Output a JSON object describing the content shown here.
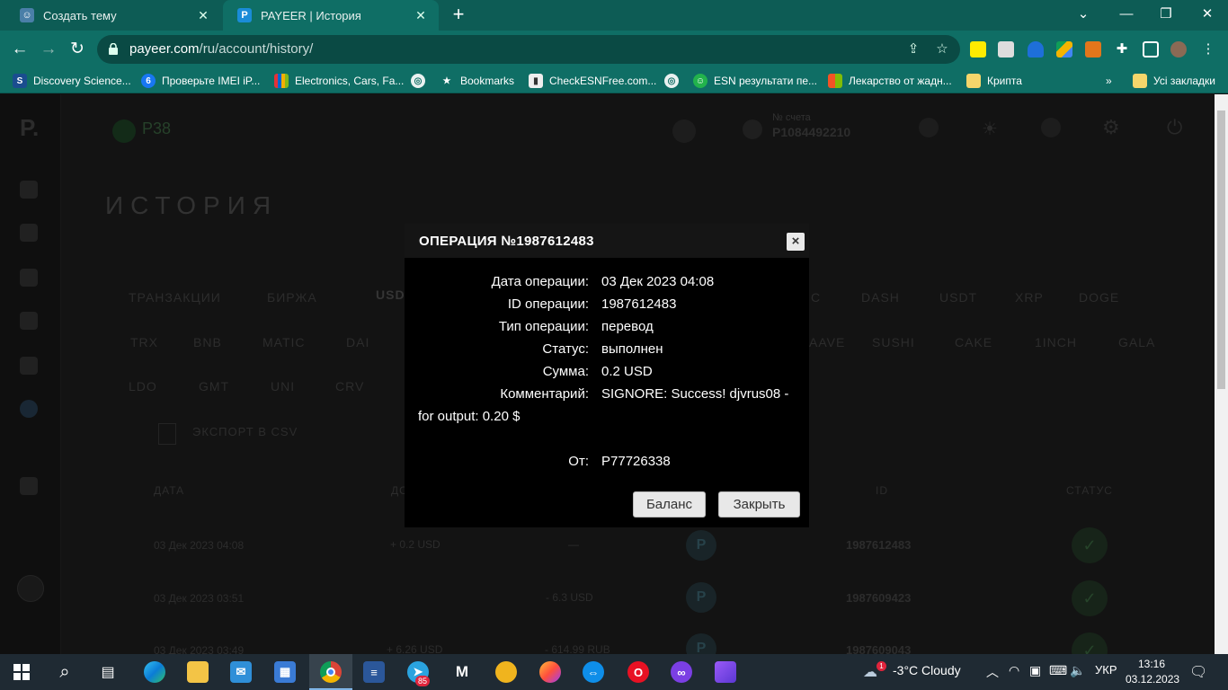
{
  "browser": {
    "tabs": [
      {
        "title": "Создать тему"
      },
      {
        "title": "PAYEER | История"
      }
    ],
    "url_domain": "payeer.com",
    "url_path": "/ru/account/history/",
    "bookmarks": [
      {
        "label": "Discovery Science..."
      },
      {
        "label": "Проверьте IMEI iP..."
      },
      {
        "label": "Electronics, Cars, Fa..."
      },
      {
        "label": "Bookmarks"
      },
      {
        "label": "CheckESNFree.com..."
      },
      {
        "label": "ESN результати пе..."
      },
      {
        "label": "Лекарство от жадн..."
      },
      {
        "label": "Крипта"
      },
      {
        "label": "Усі закладки"
      }
    ],
    "more_bookmarks": "»"
  },
  "page": {
    "balance": "P38",
    "account_label": "№ счета",
    "account_number": "P1084492210",
    "title": "ИСТОРИЯ",
    "tabs": [
      "ТРАНЗАКЦИИ",
      "БИРЖА",
      "USD"
    ],
    "currencies_row1": [
      "С",
      "DASH",
      "USDT",
      "XRP",
      "DOGE"
    ],
    "currencies_row2": [
      "TRX",
      "BNB",
      "MATIC",
      "DAI",
      "AAVE",
      "SUSHI",
      "CAKE",
      "1INCH",
      "GALA"
    ],
    "currencies_row3": [
      "LDO",
      "GMT",
      "UNI",
      "CRV"
    ],
    "export": "ЭКСПОРТ В CSV",
    "columns": [
      "ДАТА",
      "ДО",
      "ID",
      "СТАТУС"
    ],
    "rows": [
      {
        "date": "03 Дек 2023 04:08",
        "in": "+ 0.2 USD",
        "out": "—",
        "id": "1987612483"
      },
      {
        "date": "03 Дек 2023 03:51",
        "in": "",
        "out": "- 6.3 USD",
        "id": "1987609423"
      },
      {
        "date": "03 Дек 2023 03:49",
        "in": "+ 6.26 USD",
        "out": "- 614.99 RUB",
        "id": "1987609043"
      }
    ]
  },
  "modal": {
    "title": "ОПЕРАЦИЯ №1987612483",
    "close_icon": "×",
    "fields": [
      {
        "label": "Дата операции:",
        "value": "03 Дек 2023 04:08"
      },
      {
        "label": "ID операции:",
        "value": "1987612483"
      },
      {
        "label": "Тип операции:",
        "value": "перевод"
      },
      {
        "label": "Статус:",
        "value": "выполнен"
      },
      {
        "label": "Сумма:",
        "value": "0.2 USD"
      },
      {
        "label": "Комментарий:",
        "value": "SIGNORE: Success! djvrus08 -"
      }
    ],
    "comment_cont": "for output: 0.20 $",
    "from_label": "От:",
    "from_value": "P77726338",
    "balance_button": "Баланс",
    "close_button": "Закрыть"
  },
  "taskbar": {
    "weather_badge": "1",
    "weather": "-3°C  Cloudy",
    "lang": "УКР",
    "time": "13:16",
    "date": "03.12.2023",
    "telegram_badge": "85"
  },
  "colors": {
    "tabbar": "#0d5c55",
    "toolbar": "#0f6e65",
    "modal_bg": "#000000",
    "taskbar": "#1f2a33"
  }
}
